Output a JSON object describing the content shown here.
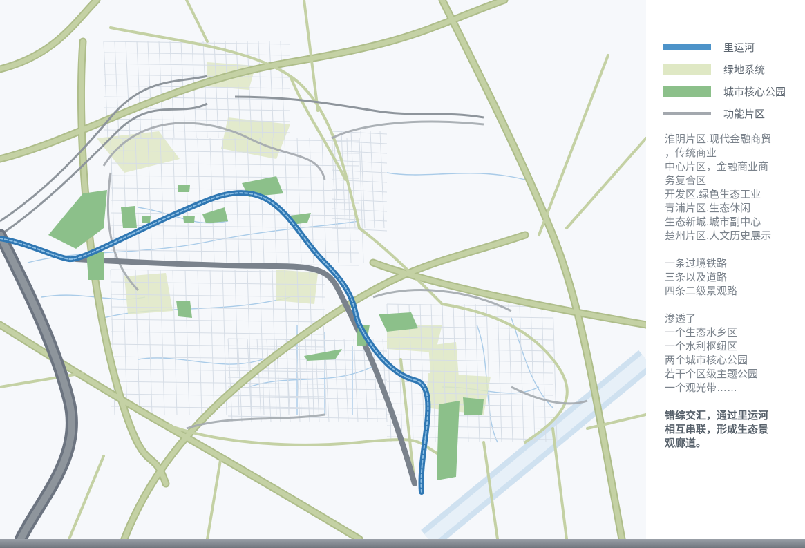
{
  "legend": {
    "items": [
      {
        "id": "canal",
        "label": "里运河",
        "color": "#4d93c9"
      },
      {
        "id": "green",
        "label": "绿地系统",
        "color": "#dfe8c4"
      },
      {
        "id": "park",
        "label": "城市核心公园",
        "color": "#8cc08a"
      },
      {
        "id": "zone",
        "label": "功能片区",
        "color": "#a3a8ae"
      }
    ]
  },
  "description": {
    "zones": [
      "淮阴片区.现代金融商贸",
      "，传统商业",
      "中心片区，金融商业商",
      "务复合区",
      "开发区.绿色生态工业",
      "青浦片区.生态休闲",
      "生态新城.城市副中心",
      "楚州片区.人文历史展示"
    ],
    "roads": [
      "一条过境铁路",
      "三条以及道路",
      "四条二级景观路"
    ],
    "permeate": [
      "渗透了",
      "一个生态水乡区",
      "一个水利枢纽区",
      "两个城市核心公园",
      "若干个区级主题公园",
      "一个观光带……"
    ],
    "summary": [
      "错综交汇，通过里运河",
      "相互串联，形成生态景",
      "观廊道。"
    ]
  },
  "colors": {
    "background": "#f6f8fb",
    "road": "#c4d1a4",
    "road_edge": "#aebd8a",
    "street": "#ffffff",
    "street_edge": "#d6dde6",
    "river": "#a9cbe8",
    "grand_canal": "#cfe1f0",
    "rail": "#6c7480",
    "canal": "#2f77b3",
    "zone_line": "#8e959c"
  }
}
